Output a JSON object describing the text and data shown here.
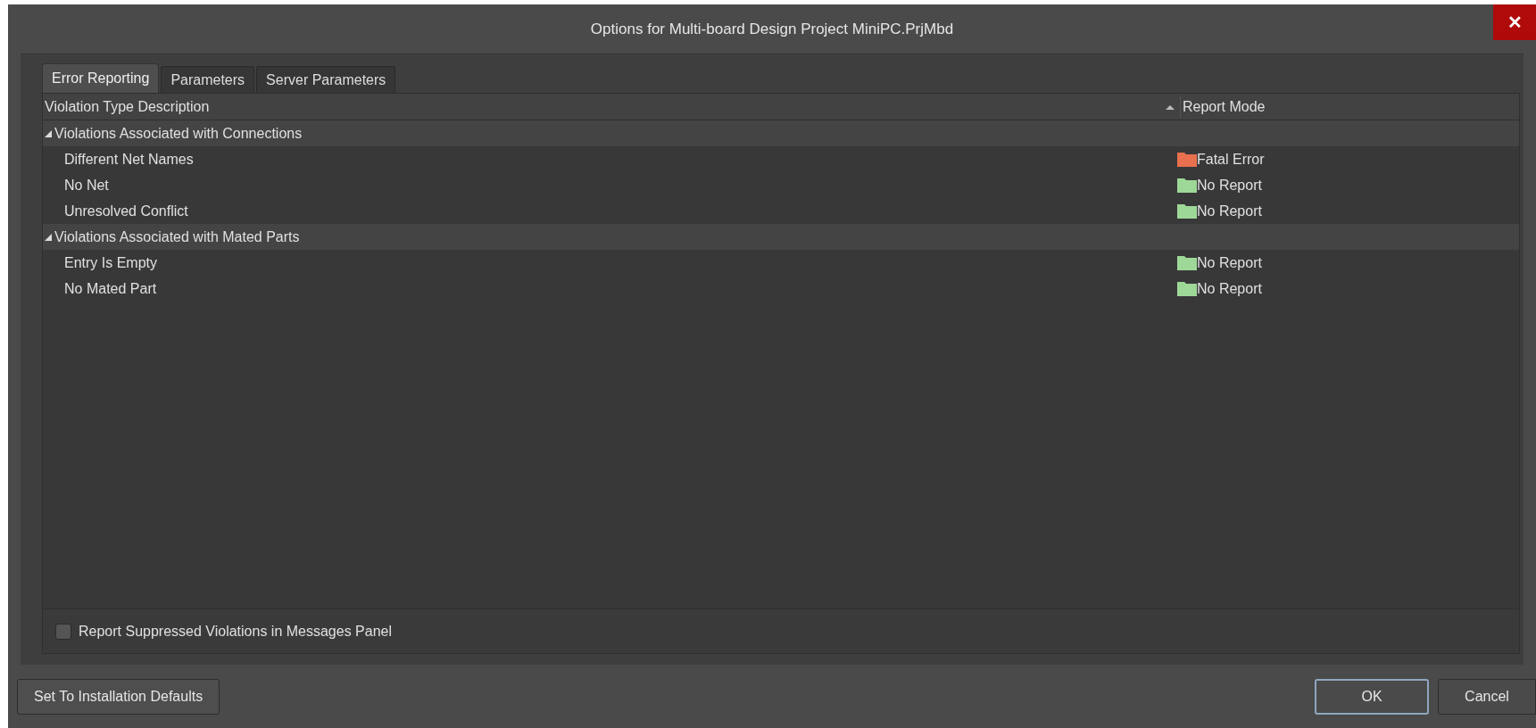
{
  "window": {
    "title": "Options for Multi-board Design Project MiniPC.PrjMbd",
    "close": "✕"
  },
  "tabs": [
    {
      "label": "Error Reporting",
      "selected": true
    },
    {
      "label": "Parameters",
      "selected": false
    },
    {
      "label": "Server Parameters",
      "selected": false
    }
  ],
  "table": {
    "columns": [
      "Violation Type Description",
      "Report Mode"
    ],
    "groups": [
      {
        "label": "Violations Associated with Connections",
        "expanded": true,
        "rows": [
          {
            "description": "Different Net Names",
            "report_mode": "Fatal Error",
            "color": "#e8704f"
          },
          {
            "description": "No Net",
            "report_mode": "No Report",
            "color": "#9ed898"
          },
          {
            "description": "Unresolved Conflict",
            "report_mode": "No Report",
            "color": "#9ed898"
          }
        ]
      },
      {
        "label": "Violations Associated with Mated Parts",
        "expanded": true,
        "rows": [
          {
            "description": "Entry Is Empty",
            "report_mode": "No Report",
            "color": "#9ed898"
          },
          {
            "description": "No Mated Part",
            "report_mode": "No Report",
            "color": "#9ed898"
          }
        ]
      }
    ]
  },
  "option": {
    "label": "Report Suppressed Violations in Messages Panel",
    "checked": false
  },
  "buttons": {
    "defaults": "Set To Installation Defaults",
    "ok": "OK",
    "cancel": "Cancel"
  }
}
